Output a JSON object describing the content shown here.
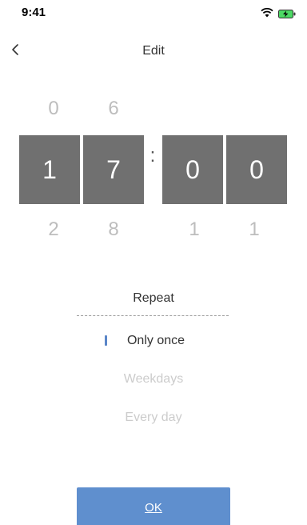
{
  "status_bar": {
    "time": "9:41"
  },
  "header": {
    "title": "Edit"
  },
  "time_picker": {
    "hour_tens": {
      "above": "0",
      "value": "1",
      "below": "2"
    },
    "hour_ones": {
      "above": "6",
      "value": "7",
      "below": "8"
    },
    "separator": ":",
    "minute_tens": {
      "above": "",
      "value": "0",
      "below": "1"
    },
    "minute_ones": {
      "above": "",
      "value": "0",
      "below": "1"
    }
  },
  "repeat": {
    "label": "Repeat",
    "options": [
      "Only once",
      "Weekdays",
      "Every day"
    ],
    "selected_index": 0
  },
  "ok_label": "OK",
  "colors": {
    "accent": "#5f8fce",
    "tile": "#707070",
    "muted": "#cccccc"
  }
}
